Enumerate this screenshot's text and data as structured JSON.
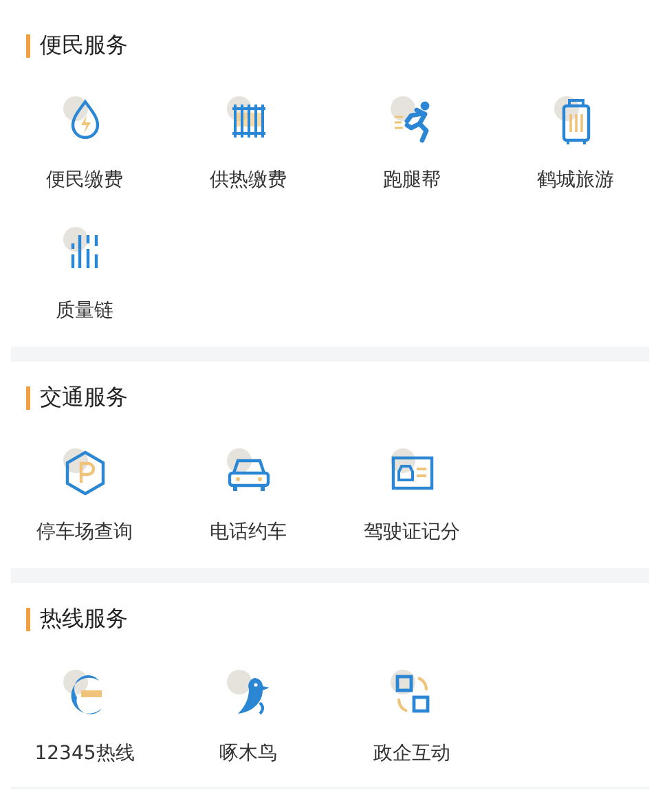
{
  "sections": [
    {
      "title": "便民服务",
      "items": [
        {
          "label": "便民缴费"
        },
        {
          "label": "供热缴费"
        },
        {
          "label": "跑腿帮"
        },
        {
          "label": "鹤城旅游"
        },
        {
          "label": "质量链"
        }
      ]
    },
    {
      "title": "交通服务",
      "items": [
        {
          "label": "停车场查询"
        },
        {
          "label": "电话约车"
        },
        {
          "label": "驾驶证记分"
        }
      ]
    },
    {
      "title": "热线服务",
      "items": [
        {
          "label": "12345热线"
        },
        {
          "label": "啄木鸟"
        },
        {
          "label": "政企互动"
        }
      ]
    }
  ]
}
